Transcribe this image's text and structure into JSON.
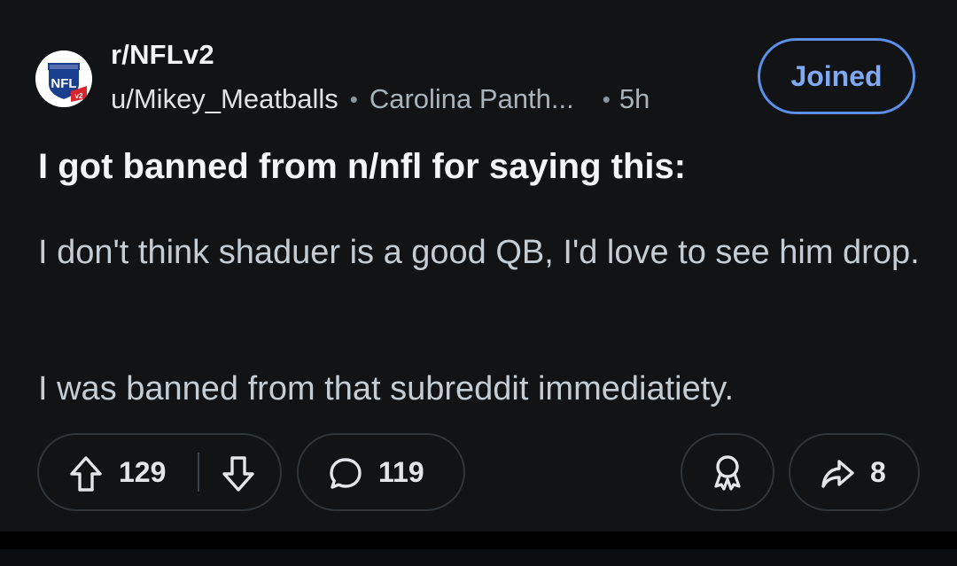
{
  "post": {
    "subreddit": "r/NFLv2",
    "avatar_label": "NFL",
    "avatar_badge": "v2",
    "username": "u/Mikey_Meatballs",
    "separator": "•",
    "flair": "Carolina Panth...",
    "time": "5h",
    "join_label": "Joined",
    "title": "I got banned from n/nfl for saying this:",
    "body": [
      "I don't think shaduer is a good QB, I'd love to see him drop.",
      "I was banned from that subreddit immediatiety."
    ]
  },
  "actions": {
    "upvotes": "129",
    "comments": "119",
    "shares": "8"
  },
  "icons": {
    "upvote": "upvote-arrow-icon",
    "downvote": "downvote-arrow-icon",
    "comment": "comment-bubble-icon",
    "award": "award-ribbon-icon",
    "share": "share-arrow-icon"
  },
  "colors": {
    "background": "#111315",
    "accent": "#5b8fe8",
    "text_primary": "#f2f4f5",
    "text_secondary": "#a9b3ba"
  }
}
